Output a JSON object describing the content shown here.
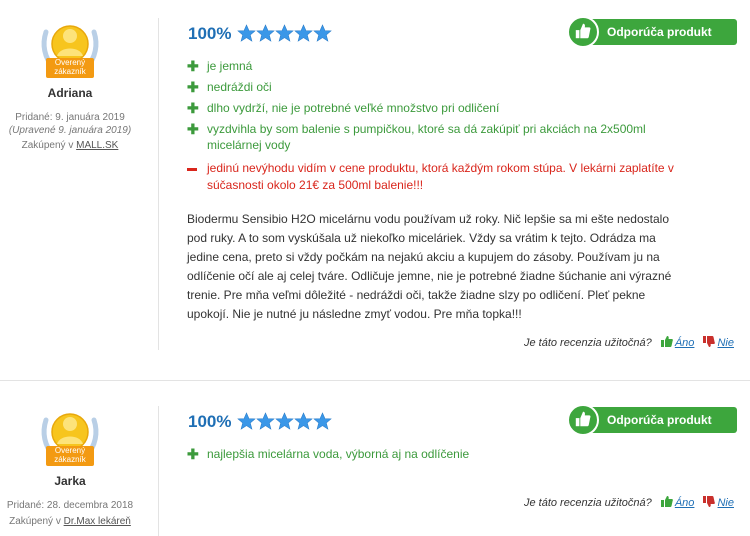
{
  "reviews": [
    {
      "badge_text": [
        "Overený",
        "zákazník"
      ],
      "user": "Adriana",
      "added": "Pridané: 9. januára 2019",
      "edited": "(Upravené 9. januára 2019)",
      "purchased_prefix": "Zakúpený v ",
      "purchased_store": "MALL.SK",
      "percent": "100%",
      "stars": 5,
      "recommend": "Odporúča produkt",
      "pros": [
        "je jemná",
        "nedráždi oči",
        "dlho vydrží, nie je potrebné veľké množstvo pri odličení",
        "vyzdvihla by som balenie s pumpičkou, ktoré sa dá zakúpiť pri akciách na 2x500ml micelárnej vody"
      ],
      "cons": [
        "jedinú nevýhodu vidím v cene produktu, ktorá každým rokom stúpa. V lekárni zaplatíte v súčasnosti okolo 21€ za 500ml balenie!!!"
      ],
      "text": "Biodermu Sensibio H2O micelárnu vodu používam už roky. Nič lepšie sa mi ešte nedostalo pod ruky. A to som vyskúšala už niekoľko miceláriek. Vždy sa vrátim k tejto. Odrádza ma jedine cena, preto si vždy počkám na nejakú akciu a kupujem do zásoby. Používam ju na odlíčenie očí ale aj celej tváre. Odličuje jemne, nie je potrebné žiadne šúchanie ani výrazné trenie. Pre mňa veľmi dôležité - nedráždi oči, takže žiadne slzy po odličení. Pleť pekne upokojí. Nie je nutné ju následne zmyť vodou. Pre mňa topka!!!",
      "helpful_q": "Je táto recenzia užitočná?",
      "yes": "Áno",
      "no": "Nie"
    },
    {
      "badge_text": [
        "Overený",
        "zákazník"
      ],
      "user": "Jarka",
      "added": "Pridané: 28. decembra 2018",
      "purchased_prefix": "Zakúpený v ",
      "purchased_store": "Dr.Max lekáreň",
      "percent": "100%",
      "stars": 5,
      "recommend": "Odporúča produkt",
      "pros": [
        "najlepšia micelárna voda, výborná aj na odlíčenie"
      ],
      "helpful_q": "Je táto recenzia užitočná?",
      "yes": "Áno",
      "no": "Nie"
    }
  ],
  "colors": {
    "green": "#3da63d",
    "blue": "#1f6fb5",
    "red": "#d9261c",
    "star": "#3a97e8"
  }
}
